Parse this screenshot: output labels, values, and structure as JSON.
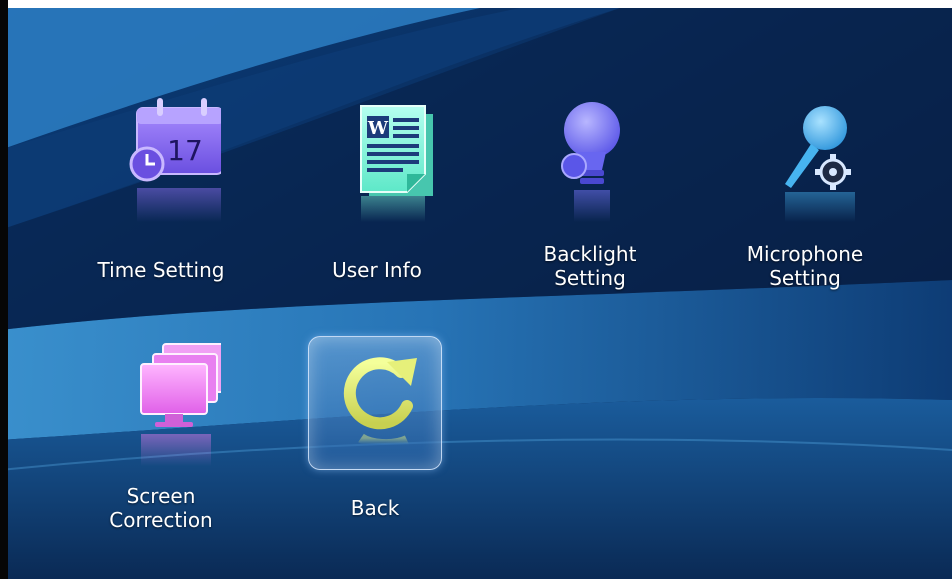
{
  "menu": {
    "tiles": [
      {
        "id": "time",
        "label": [
          "Time Setting"
        ],
        "icon": "calendar-clock-icon",
        "calendar_day": "17"
      },
      {
        "id": "user",
        "label": [
          "User Info"
        ],
        "icon": "word-document-icon",
        "doc_letter": "W"
      },
      {
        "id": "backlight",
        "label": [
          "Backlight",
          "Setting"
        ],
        "icon": "lightbulb-icon"
      },
      {
        "id": "mic",
        "label": [
          "Microphone",
          "Setting"
        ],
        "icon": "microphone-gear-icon"
      },
      {
        "id": "screen",
        "label": [
          "Screen",
          "Correction"
        ],
        "icon": "monitor-stack-icon"
      },
      {
        "id": "back",
        "label": [
          "Back"
        ],
        "icon": "refresh-arrow-icon",
        "selected": true
      }
    ]
  },
  "colors": {
    "background_dark": "#071a3a",
    "background_light": "#2f7fc0",
    "calendar": "#8c6ff0",
    "document": "#7af2d8",
    "bulb": "#7a78ff",
    "mic": "#47b4f0",
    "monitor": "#f07cf0",
    "refresh": "#e6f07a"
  }
}
